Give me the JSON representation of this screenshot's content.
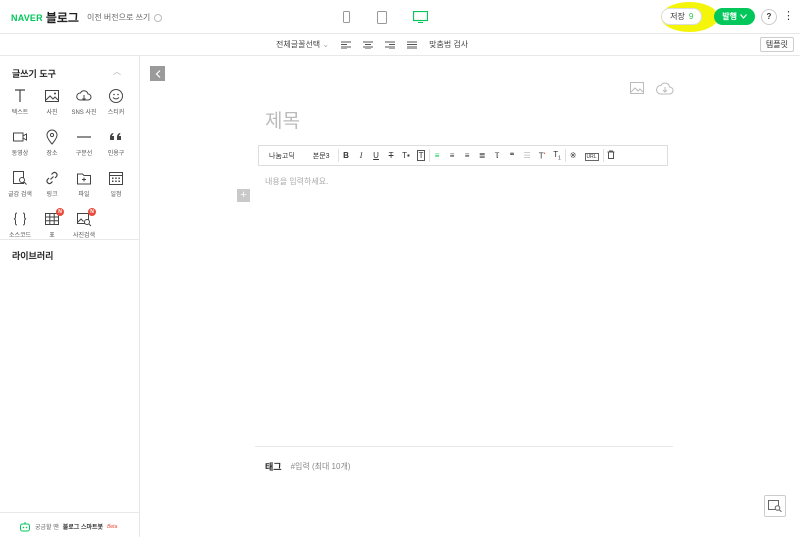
{
  "header": {
    "brand_naver": "NAVER",
    "brand_blog": "블로그",
    "prev_version": "이전 버전으로 쓰기",
    "save_label": "저장",
    "save_count": "9",
    "publish_label": "발행",
    "help_label": "?",
    "more_label": "⋮"
  },
  "subbar": {
    "font_select": "전체글꼴선택",
    "spellcheck": "맞춤법 검사",
    "template": "템플릿"
  },
  "sidebar": {
    "title": "글쓰기 도구",
    "tools": [
      {
        "label": "텍스트",
        "icon": "text-icon"
      },
      {
        "label": "사진",
        "icon": "photo-icon"
      },
      {
        "label": "SNS 사진",
        "icon": "cloud-icon"
      },
      {
        "label": "스티커",
        "icon": "sticker-icon"
      },
      {
        "label": "동영상",
        "icon": "video-icon"
      },
      {
        "label": "장소",
        "icon": "location-icon"
      },
      {
        "label": "구분선",
        "icon": "divider-icon"
      },
      {
        "label": "인용구",
        "icon": "quote-icon"
      },
      {
        "label": "글감 검색",
        "icon": "search-doc-icon"
      },
      {
        "label": "링크",
        "icon": "link-icon"
      },
      {
        "label": "파일",
        "icon": "file-icon"
      },
      {
        "label": "일정",
        "icon": "calendar-icon"
      },
      {
        "label": "소스코드",
        "icon": "code-icon"
      },
      {
        "label": "표",
        "icon": "table-icon",
        "badge": "N"
      },
      {
        "label": "사진검색",
        "icon": "image-search-icon",
        "badge": "N"
      }
    ],
    "library": "라이브러리",
    "smartbot_prefix": "궁금할 땐",
    "smartbot_name": "블로그 스마트봇",
    "smartbot_beta": "Beta"
  },
  "editor": {
    "title_placeholder": "제목",
    "body_placeholder": "내용을 입력하세요.",
    "font_name": "나눔고딕",
    "font_style": "본문3",
    "tag_label": "태그",
    "tag_placeholder": "#입력 (최대 10개)"
  },
  "colors": {
    "brand_green": "#03c75a",
    "highlight_yellow": "#f5f50a"
  }
}
